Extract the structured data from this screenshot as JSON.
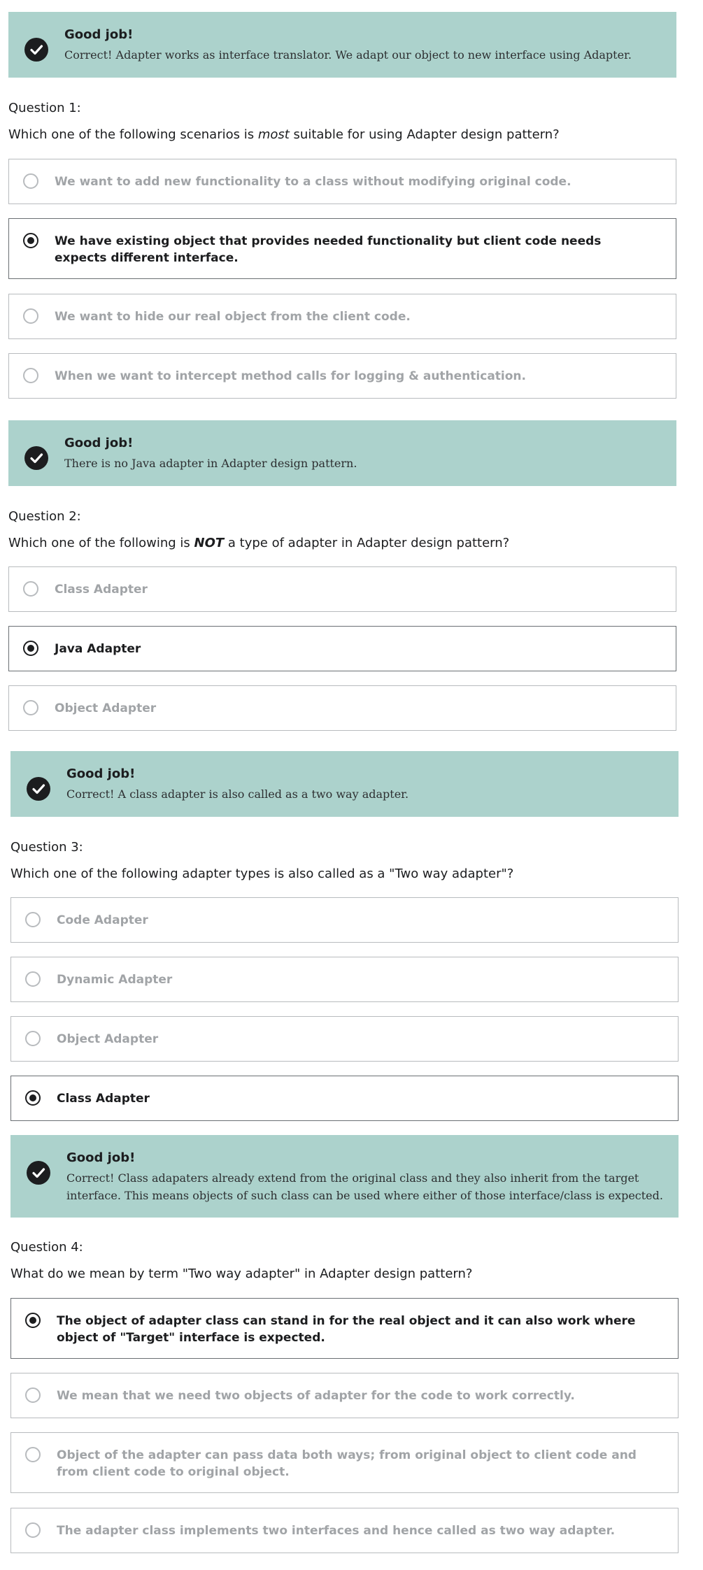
{
  "sections": [
    {
      "feedback": {
        "title": "Good job!",
        "text": "Correct! Adapter works as interface translator. We adapt our object to new interface using Adapter."
      },
      "question_number": "Question 1:",
      "question_parts": [
        "Which one of the following scenarios is ",
        "most",
        " suitable for using Adapter design pattern?"
      ],
      "options": [
        {
          "label": "We want to add new functionality to a class without modifying original code.",
          "selected": false
        },
        {
          "label": "We have existing object that provides needed functionality but client code needs expects different interface.",
          "selected": true
        },
        {
          "label": "We want to hide our real object from the client code.",
          "selected": false
        },
        {
          "label": "When we want to intercept method calls for logging & authentication.",
          "selected": false
        }
      ]
    },
    {
      "feedback": {
        "title": "Good job!",
        "text": "There is no Java adapter in Adapter design pattern."
      },
      "question_number": "Question 2:",
      "question_parts": [
        "Which one of the following is ",
        "NOT",
        " a type of adapter in Adapter design pattern?"
      ],
      "options": [
        {
          "label": "Class Adapter",
          "selected": false
        },
        {
          "label": "Java Adapter",
          "selected": true
        },
        {
          "label": "Object Adapter",
          "selected": false
        }
      ]
    },
    {
      "feedback": {
        "title": "Good job!",
        "text": "Correct! A class adapter is also called as a two way adapter."
      },
      "question_number": "Question 3:",
      "question_text": "Which one of the following adapter types is also called as a \"Two way adapter\"?",
      "options": [
        {
          "label": "Code Adapter",
          "selected": false
        },
        {
          "label": "Dynamic Adapter",
          "selected": false
        },
        {
          "label": "Object Adapter",
          "selected": false
        },
        {
          "label": "Class Adapter",
          "selected": true
        }
      ]
    },
    {
      "feedback": {
        "title": "Good job!",
        "text": "Correct! Class adapaters already extend from the original class and they also inherit from the target interface. This means objects of such class can be used where either of those interface/class is expected."
      },
      "question_number": "Question 4:",
      "question_text": "What do we mean by term \"Two way adapter\" in Adapter design pattern?",
      "options": [
        {
          "label": "The object of adapter class can stand in for the real object and it can also work where object of \"Target\" interface is expected.",
          "selected": true
        },
        {
          "label": "We mean that we need two objects of adapter for the code to work correctly.",
          "selected": false
        },
        {
          "label": "Object of the adapter can pass data both ways; from original object to client code and from client code to original object.",
          "selected": false
        },
        {
          "label": "The adapter class implements two interfaces and hence called as two way adapter.",
          "selected": false
        }
      ]
    }
  ],
  "colors": {
    "feedback_bg": "#acd2cc",
    "text": "#1c1d1f",
    "muted": "#a1a4a7",
    "border": "#b8bbbe"
  },
  "icons": {
    "feedback": "check-circle-icon",
    "radio": "radio-icon"
  }
}
